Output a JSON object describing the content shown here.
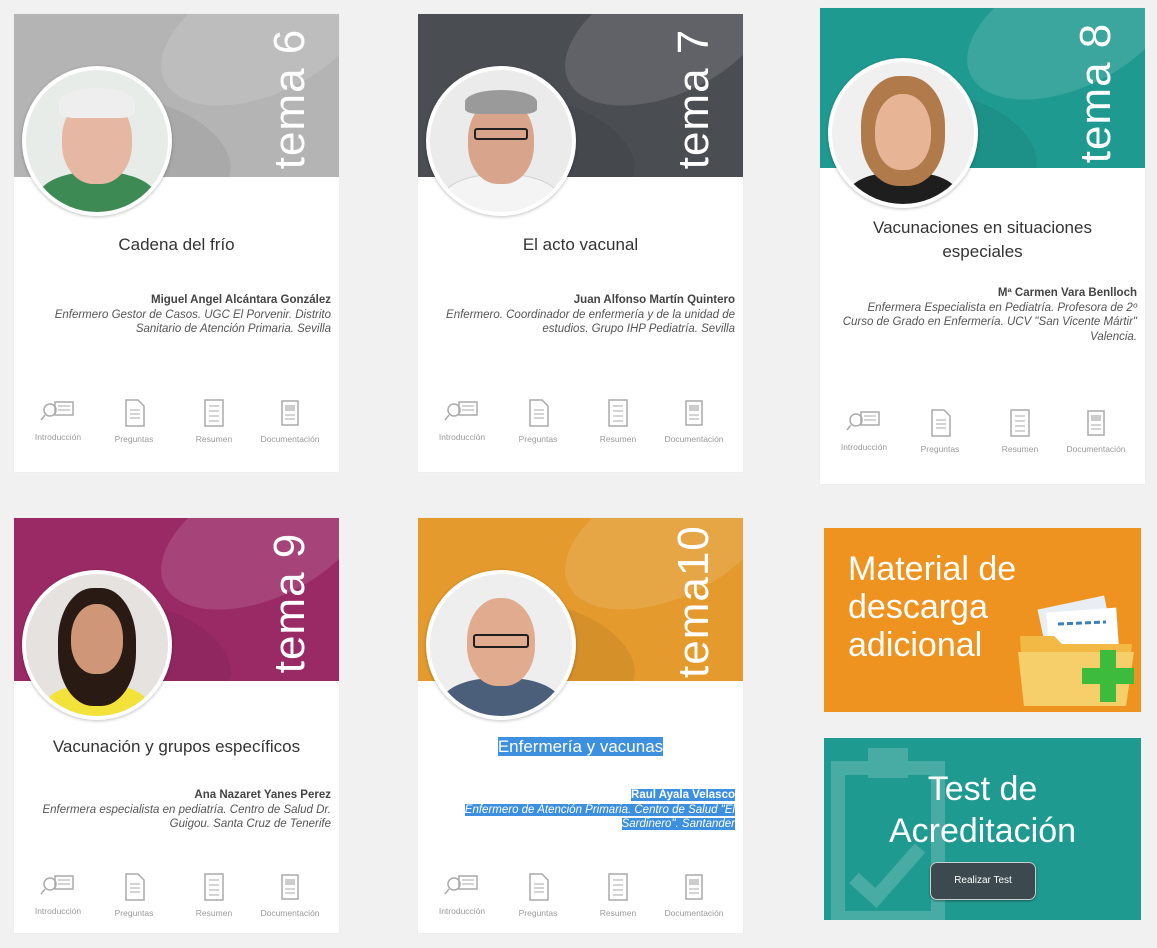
{
  "colors": {
    "tema6": "#b4b4b4",
    "tema7": "#4a4d52",
    "tema8": "#1f9a90",
    "tema9": "#9a2a66",
    "tema10": "#e49a2c",
    "material": "#ef9320",
    "test": "#1f9a90"
  },
  "cards": [
    {
      "tema": "tema 6",
      "title": "Cadena del frío",
      "author_name": "Miguel Angel Alcántara González",
      "author_role": "Enfermero Gestor de Casos. UGC El Porvenir. Distrito Sanitario de Atención Primaria. Sevilla",
      "icons": [
        "Introducción",
        "Preguntas",
        "Resumen",
        "Documentación"
      ]
    },
    {
      "tema": "tema 7",
      "title": "El acto vacunal",
      "author_name": "Juan Alfonso Martín Quintero",
      "author_role": "Enfermero. Coordinador de enfermería y de la unidad de estudios. Grupo IHP Pediatría. Sevilla",
      "icons": [
        "Introducción",
        "Preguntas",
        "Resumen",
        "Documentación"
      ]
    },
    {
      "tema": "tema 8",
      "title": "Vacunaciones en situaciones especiales",
      "author_name": "Mª Carmen Vara Benlloch",
      "author_role": "Enfermera Especialista en Pediatría. Profesora de 2º Curso de Grado en Enfermería. UCV \"San Vicente Mártir\" Valencia.",
      "icons": [
        "Introducción",
        "Preguntas",
        "Resumen",
        "Documentación"
      ]
    },
    {
      "tema": "tema 9",
      "title": "Vacunación y grupos específicos",
      "author_name": "Ana Nazaret Yanes Perez",
      "author_role": "Enfermera especialista en pediatría. Centro de Salud Dr. Guigou. Santa Cruz de Tenerife",
      "icons": [
        "Introducción",
        "Preguntas",
        "Resumen",
        "Documentación"
      ]
    },
    {
      "tema": "tema10",
      "title": "Enfermería y vacunas",
      "author_name": "Raul Ayala Velasco",
      "author_role": "Enfermero de Atención Primaria. Centro de Salud \"El Sardinero\". Santander",
      "icons": [
        "Introducción",
        "Preguntas",
        "Resumen",
        "Documentación"
      ]
    }
  ],
  "material": {
    "line1": "Material de",
    "line2": "descarga",
    "line3": "adicional"
  },
  "test": {
    "line1": "Test de",
    "line2": "Acreditación",
    "button": "Realizar Test"
  }
}
